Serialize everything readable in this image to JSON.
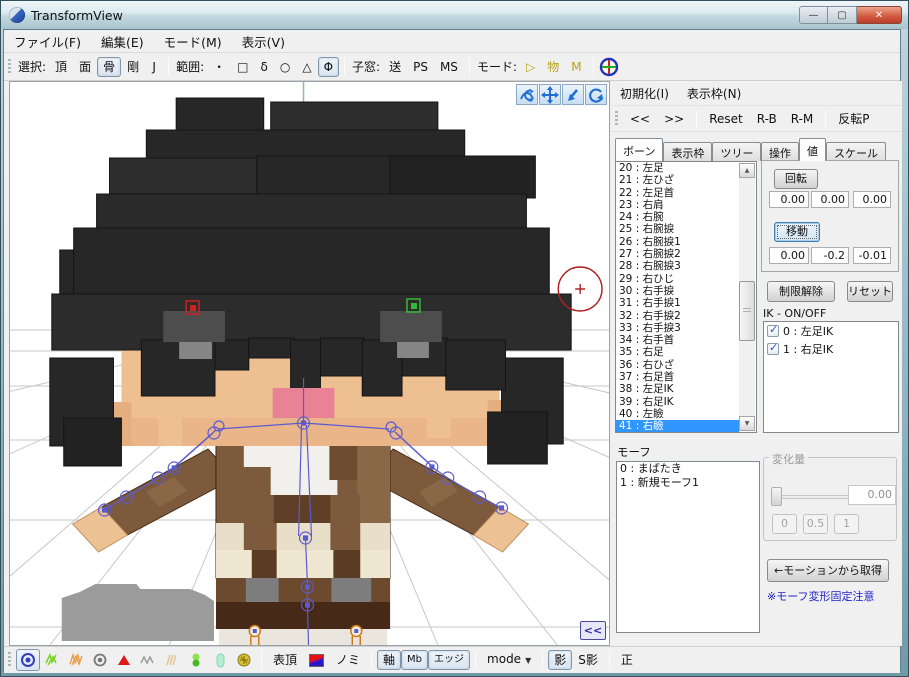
{
  "window": {
    "title": "TransformView",
    "minimize": "—",
    "maximize": "▢",
    "close": "✕"
  },
  "menubar": [
    "ファイル(F)",
    "編集(E)",
    "モード(M)",
    "表示(V)"
  ],
  "toolbar": {
    "select": {
      "label": "選択:",
      "items": [
        {
          "t": "頂"
        },
        {
          "t": "面"
        },
        {
          "t": "骨",
          "on": true
        },
        {
          "t": "剛"
        },
        {
          "t": "J"
        }
      ]
    },
    "range": {
      "label": "範囲:",
      "items": [
        {
          "t": "・"
        },
        {
          "t": "□"
        },
        {
          "t": "δ"
        },
        {
          "t": "○"
        },
        {
          "t": "△"
        },
        {
          "t": "Φ",
          "on": true
        }
      ]
    },
    "subwindow": {
      "label": "子窓:",
      "items": [
        {
          "t": "送"
        },
        {
          "t": "PS"
        },
        {
          "t": "MS"
        }
      ]
    },
    "mode": {
      "label": "モード:",
      "items": [
        {
          "t": "▷"
        },
        {
          "t": "物"
        },
        {
          "t": "M"
        }
      ]
    },
    "compass_icon": "axis-compass-icon"
  },
  "viewport": {
    "collapse": "<<",
    "nav_icons": [
      "orbit-icon",
      "pan-icon",
      "zoom-icon",
      "rotate-view-icon"
    ]
  },
  "right_panel": {
    "menu": [
      "初期化(I)",
      "表示枠(N)"
    ],
    "nav_group": [
      "<<",
      ">>"
    ],
    "reset_group": [
      "Reset",
      "R-B",
      "R-M"
    ],
    "flip_group": [
      "反転P"
    ],
    "left_tabs": [
      {
        "t": "ボーン",
        "on": true
      },
      {
        "t": "表示枠"
      },
      {
        "t": "ツリー"
      }
    ],
    "right_tabs": [
      {
        "t": "操作"
      },
      {
        "t": "値",
        "on": true
      },
      {
        "t": "スケール"
      }
    ],
    "bones": [
      "20 : 左足",
      "21 : 左ひざ",
      "22 : 左足首",
      "23 : 右肩",
      "24 : 右腕",
      "25 : 右腕捩",
      "26 : 右腕捩1",
      "27 : 右腕捩2",
      "28 : 右腕捩3",
      "29 : 右ひじ",
      "30 : 右手捩",
      "31 : 右手捩1",
      "32 : 右手捩2",
      "33 : 右手捩3",
      "34 : 右手首",
      "35 : 右足",
      "36 : 右ひざ",
      "37 : 右足首",
      "38 : 左足IK",
      "39 : 右足IK",
      "40 : 左瞼",
      "41 : 右瞼"
    ],
    "selected_bone": "41 : 右瞼",
    "rotate": {
      "button": "回転",
      "x": "0.00",
      "y": "0.00",
      "z": "0.00"
    },
    "move": {
      "button": "移動",
      "x": "0.00",
      "y": "-0.2",
      "z": "-0.01"
    },
    "unlock_button": "制限解除",
    "reset_button": "リセット",
    "ik": {
      "label": "IK - ON/OFF",
      "items": [
        {
          "label": "0 : 左足IK",
          "on": true
        },
        {
          "label": "1 : 右足IK",
          "on": true
        }
      ]
    },
    "morph": {
      "label": "モーフ",
      "items": [
        "0 : まばたき",
        "1 : 新規モーフ1"
      ]
    },
    "change": {
      "label": "変化量",
      "value": "0.00",
      "buttons": [
        "0",
        "0.5",
        "1"
      ],
      "disabled": true
    },
    "motion_button": "←モーションから取得",
    "warning": "※モーフ変形固定注意"
  },
  "bottom_bar": {
    "icon_names": [
      "vertex-select-icon",
      "hatch-green-icon",
      "hatch-orange-icon",
      "vertex-gray-icon",
      "triangle-red-icon",
      "wave-gray-icon",
      "wave-orange-icon",
      "capsule-green-icon",
      "capsule-cyan-icon",
      "knot-yellow-icon",
      "material-color-swatch"
    ],
    "hyocho": "表頂",
    "nomi": "ノミ",
    "axis": "軸",
    "mb": "Mb",
    "edge": "エッジ",
    "mode": "mode",
    "shadow": "影",
    "s_shadow": "S影",
    "normal": "正"
  },
  "colors": {
    "selection": "#3196ff",
    "warning_text": "#1f1fc8",
    "viewport_bg": "#ffffff",
    "panel_bg": "#f0f0f0",
    "close_button": "#c8503a"
  }
}
